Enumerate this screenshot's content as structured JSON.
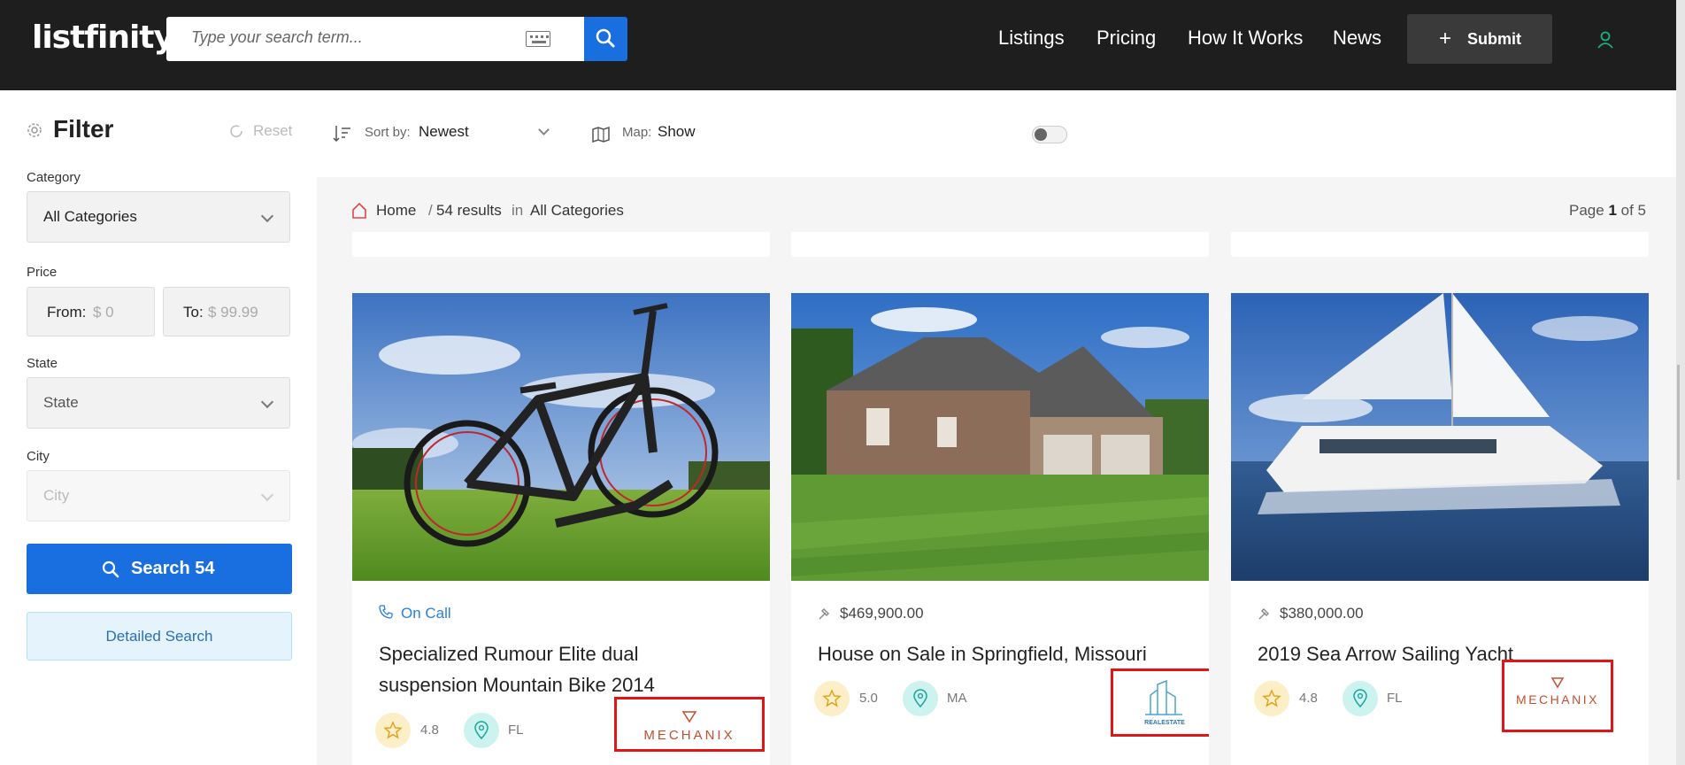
{
  "header": {
    "logo": "listfinity",
    "search_placeholder": "Type your search term...",
    "nav": [
      "Listings",
      "Pricing",
      "How It Works",
      "News"
    ],
    "submit_label": "Submit"
  },
  "sidebar": {
    "title": "Filter",
    "reset_label": "Reset",
    "category_label": "Category",
    "category_value": "All Categories",
    "price_label": "Price",
    "price_from_label": "From:",
    "price_from_placeholder": "$ 0",
    "price_to_label": "To:",
    "price_to_placeholder": "$ 99.99",
    "state_label": "State",
    "state_value": "State",
    "city_label": "City",
    "city_value": "City",
    "search_button": "Search 54",
    "detailed_search": "Detailed Search"
  },
  "toolbar": {
    "sort_label": "Sort by:",
    "sort_value": "Newest",
    "map_label": "Map:",
    "map_value": "Show"
  },
  "breadcrumb": {
    "home": "Home",
    "sep": "/",
    "results": "54 results",
    "in": "in",
    "category": "All Categories"
  },
  "pagination": {
    "prefix": "Page",
    "current": "1",
    "of": "of 5"
  },
  "cards": [
    {
      "meta": "On Call",
      "title": "Specialized Rumour Elite dual suspension Mountain Bike 2014",
      "rating": "4.8",
      "location": "FL",
      "brand": "MECHANIX"
    },
    {
      "meta": "$469,900.00",
      "title": "House on Sale in Springfield, Missouri",
      "rating": "5.0",
      "location": "MA",
      "brand": "REALESTATE"
    },
    {
      "meta": "$380,000.00",
      "title": "2019 Sea Arrow Sailing Yacht",
      "rating": "4.8",
      "location": "FL",
      "brand": "MECHANIX"
    }
  ],
  "colors": {
    "header_bg": "#1e1e1e",
    "accent_blue": "#1a6fe0",
    "highlight_red": "#e01515",
    "badge_yellow": "#fcefc7",
    "badge_teal": "#ccf3ef"
  }
}
